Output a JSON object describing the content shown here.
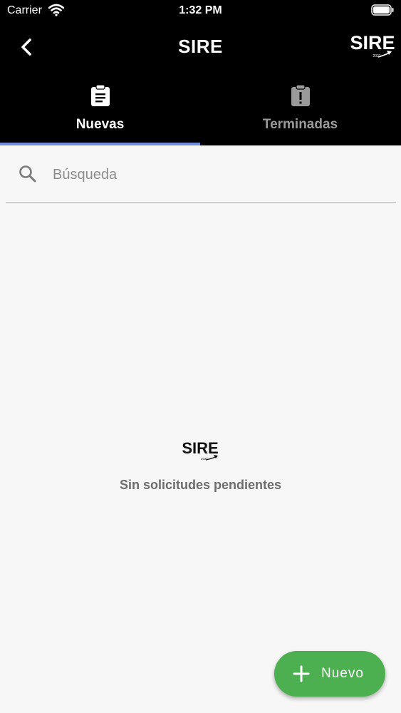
{
  "status_bar": {
    "carrier": "Carrier",
    "time": "1:32 PM"
  },
  "header": {
    "title": "SIRE",
    "logo_text": "SIRE",
    "logo_year": "2021"
  },
  "tabs": [
    {
      "label": "Nuevas",
      "icon": "clipboard-icon",
      "selected": true
    },
    {
      "label": "Terminadas",
      "icon": "clipboard-alert-icon",
      "selected": false
    }
  ],
  "search": {
    "placeholder": "Búsqueda",
    "value": ""
  },
  "empty_state": {
    "logo_text": "SIRE",
    "logo_year": "2021",
    "message": "Sin solicitudes pendientes"
  },
  "fab": {
    "label": "Nuevo",
    "icon": "plus-icon"
  },
  "colors": {
    "accent": "#6f8fdc",
    "fab": "#4caf50",
    "header_bg": "#000000",
    "background": "#f7f7f7"
  }
}
